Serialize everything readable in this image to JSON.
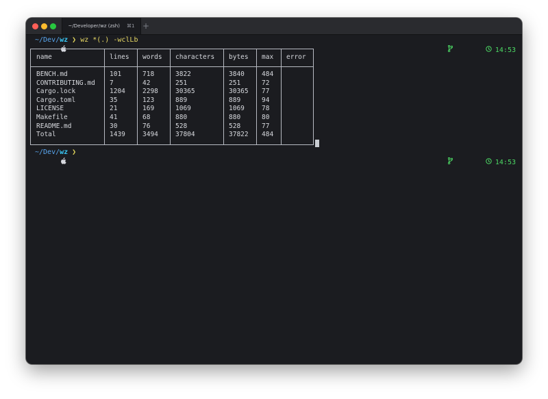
{
  "tab": {
    "title": "~/Developer/wz (zsh)",
    "shortcut": "⌘1",
    "new_tab": "+"
  },
  "prompt1": {
    "path_base": "~/Dev/",
    "path_cur": "wz",
    "chevron": "❯",
    "command": "wz",
    "args": "*(.)",
    "flags": "-wclLb",
    "time": "14:53"
  },
  "table": {
    "headers": [
      "name",
      "lines",
      "words",
      "characters",
      "bytes",
      "max",
      "error"
    ],
    "rows": [
      [
        "BENCH.md",
        "101",
        "718",
        "3822",
        "3840",
        "484",
        ""
      ],
      [
        "CONTRIBUTING.md",
        "7",
        "42",
        "251",
        "251",
        "72",
        ""
      ],
      [
        "Cargo.lock",
        "1204",
        "2298",
        "30365",
        "30365",
        "77",
        ""
      ],
      [
        "Cargo.toml",
        "35",
        "123",
        "889",
        "889",
        "94",
        ""
      ],
      [
        "LICENSE",
        "21",
        "169",
        "1069",
        "1069",
        "78",
        ""
      ],
      [
        "Makefile",
        "41",
        "68",
        "880",
        "880",
        "80",
        ""
      ],
      [
        "README.md",
        "30",
        "76",
        "528",
        "528",
        "77",
        ""
      ],
      [
        "Total",
        "1439",
        "3494",
        "37804",
        "37822",
        "484",
        ""
      ]
    ]
  },
  "prompt2": {
    "path_base": "~/Dev/",
    "path_cur": "wz",
    "chevron": "❯",
    "time": "14:53"
  },
  "icons": {
    "prompt": "apple-icon",
    "branch": "git-branch-icon",
    "clock": "clock-icon"
  },
  "colors": {
    "background": "#1b1c20",
    "path": "#5aa8f2",
    "command": "#e8d964",
    "time": "#4cd964"
  }
}
